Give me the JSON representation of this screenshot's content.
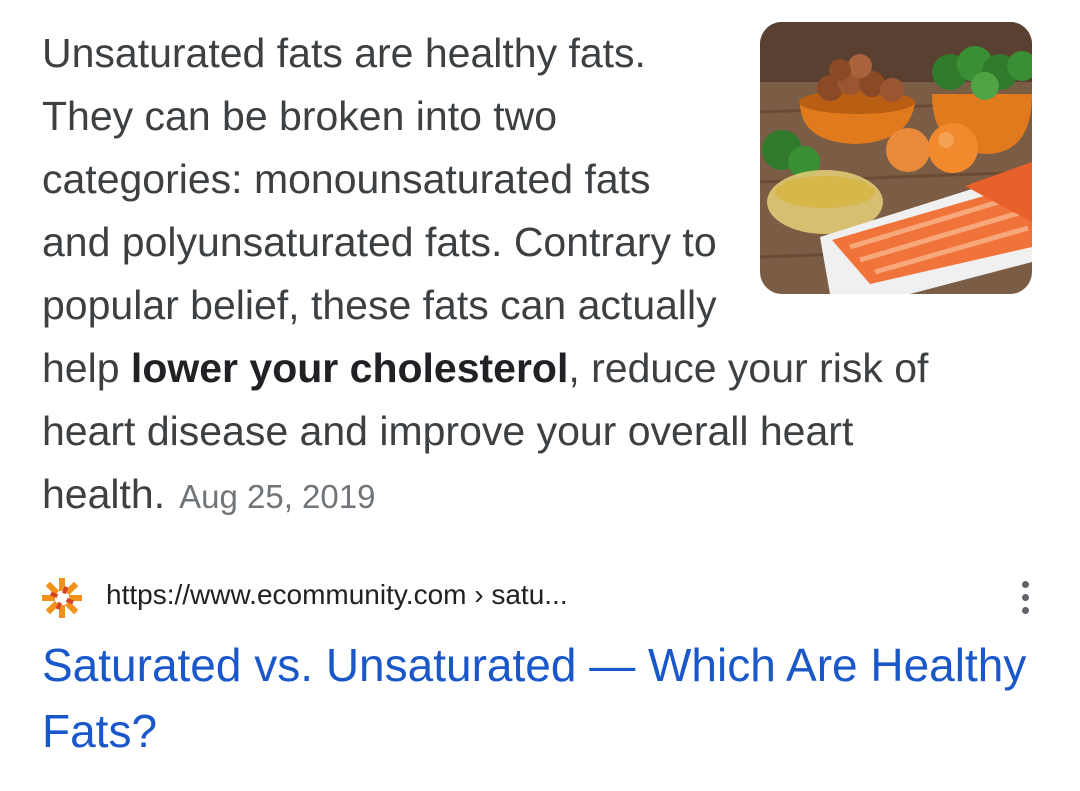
{
  "snippet": {
    "text_before_bold": "Unsaturated fats are healthy fats. They can be broken into two categories: monounsaturated fats and polyunsaturated fats. Contrary to popular belief, these fats can actually help ",
    "bold_text": "lower your cholesterol",
    "text_after_bold": ", reduce your risk of heart disease and improve your overall heart health.",
    "date": "Aug 25, 2019",
    "thumbnail_icon": "healthy-fats-food-photo"
  },
  "result": {
    "favicon_icon": "ecommunity-favicon",
    "url": "https://www.ecommunity.com › satu...",
    "title": "Saturated vs. Unsaturated — Which Are Healthy Fats?",
    "more_options_icon": "more-vert-icon"
  },
  "colors": {
    "snippet_text": "#3c4043",
    "link_title": "#1a57c9",
    "date_text": "#70757a"
  }
}
